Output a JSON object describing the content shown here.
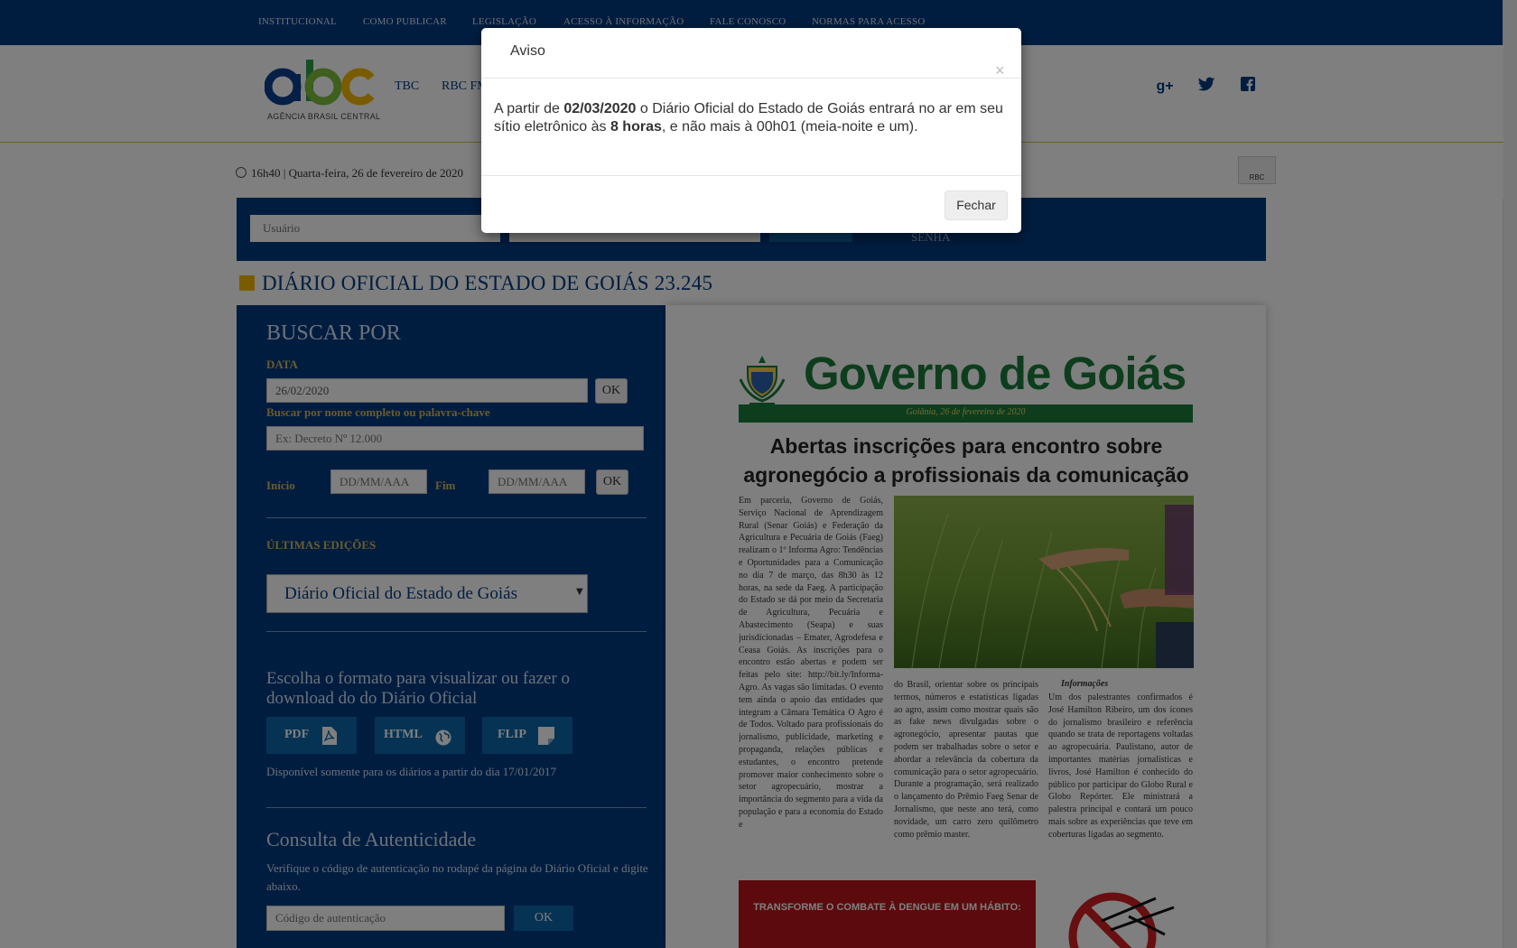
{
  "topnav": {
    "items": [
      "INSTITUCIONAL",
      "COMO PUBLICAR",
      "LEGISLAÇÃO",
      "ACESSO À INFORMAÇÃO",
      "FALE CONOSCO",
      "NORMAS PARA ACESSO"
    ]
  },
  "header": {
    "logo_text": "abc",
    "logo_subtitle": "AGÊNCIA BRASIL CENTRAL",
    "channels": [
      "TBC",
      "RBC FM"
    ],
    "social_icons": [
      "google-plus-icon",
      "twitter-icon",
      "facebook-icon"
    ]
  },
  "timebar": {
    "datetime": "16h40 | Quarta-feira, 26 de fevereiro de 2020",
    "badge": "RBC"
  },
  "login": {
    "user_placeholder": "Usuário",
    "senha_label": "SENHA"
  },
  "page": {
    "title": "DIÁRIO OFICIAL DO ESTADO DE GOIÁS 23.245"
  },
  "search": {
    "heading": "BUSCAR POR",
    "date_label": "DATA",
    "date_value": "26/02/2020",
    "ok": "OK",
    "keyword_label": "Buscar por nome completo ou palavra-chave",
    "keyword_placeholder": "Ex: Decreto Nº 12.000",
    "start_label": "Início",
    "end_label": "Fim",
    "date_placeholder": "DD/MM/AAA"
  },
  "editions": {
    "label": "ÚLTIMAS EDIÇÕES",
    "selected": "Diário Oficial do Estado de Goiás"
  },
  "formats": {
    "heading": "Escolha o formato para visualizar ou fazer o download do do Diário Oficial",
    "buttons": [
      "PDF",
      "HTML",
      "FLIP"
    ],
    "note": "Disponível somente para os diários a partir do dia 17/01/2017"
  },
  "auth": {
    "heading": "Consulta de Autenticidade",
    "text": "Verifique o código de autenticação no rodapé da página do Diário Oficial e digite abaixo.",
    "placeholder": "Código de autenticação",
    "ok": "OK"
  },
  "newspaper": {
    "masthead": "Governo de Goiás",
    "date": "Goiânia, 26 de fevereiro de 2020",
    "headline": "Abertas inscrições para encontro sobre agronegócio a profissionais da comunicação",
    "col1": "Em parceria, Governo de Goiás, Serviço Nacional de Aprendizagem Rural (Senar Goiás) e Federação da Agricultura e Pecuária de Goiás (Faeg) realizam o 1º Informa Agro: Tendências e Oportunidades para a Comunicação no dia 7 de março, das 8h30 às 12 horas, na sede da Faeg. A participação do Estado se dá por meio da Secretaria de Agricultura, Pecuária e Abastecimento (Seapa) e suas jurisdicionadas – Emater, Agrodefesa e Ceasa Goiás. As inscrições para o encontro estão abertas e podem ser feitas pelo site: http://bit.ly/Informa-Agro. As vagas são limitadas. O evento tem ainda o apoio das entidades que integram a Câmara Temática O Agro é de Todos. Voltado para profissionais do jornalismo, publicidade, marketing e propaganda, relações públicas e estudantes, o encontro pretende promover maior conhecimento sobre o setor agropecuário, mostrar a importância do segmento para a vida da população e para a economia do Estado e",
    "col2": "do Brasil, orientar sobre os principais termos, números e estatísticas ligadas ao agro, assim como mostrar quais são as fake news divulgadas sobre o agronegócio, apresentar pautas que podem ser trabalhadas sobre o setor e abordar a relevância da cobertura da comunicação para o setor agropecuário. Durante a programação, será realizado o lançamento do Prêmio Faeg Senar de Jornalismo, que neste ano terá, como novidade, um carro zero quilômetro como prêmio master.",
    "col3_title": "Informações",
    "col3": "Um dos palestrantes confirmados é José Hamilton Ribeiro, um dos ícones do jornalismo brasileiro e referência quando se trata de reportagens voltadas ao agropecuária. Paulistano, autor de importantes matérias jornalísticas e livros, José Hamilton é conhecido do público por participar do Globo Rural e Globo Repórter. Ele ministrará a palestra principal e contará um pouco mais sobre as experiências que teve em coberturas ligadas ao segmento.",
    "ad_text": "TRANSFORME O COMBATE À DENGUE EM UM HÁBITO:"
  },
  "modal": {
    "title": "Aviso",
    "close_symbol": "×",
    "body_1": "A partir de ",
    "body_date": "02/03/2020",
    "body_2": " o Diário Oficial do Estado de Goiás entrará no ar em seu sítio eletrônico às ",
    "body_hours": "8 horas",
    "body_3": ", e não mais à 00h01 (meia-noite e um).",
    "button": "Fechar"
  },
  "colors": {
    "brand_blue": "#003a80",
    "accent_gold": "#f5b800",
    "button_teal": "#0c67a8",
    "gov_green": "#1b7a3b"
  }
}
